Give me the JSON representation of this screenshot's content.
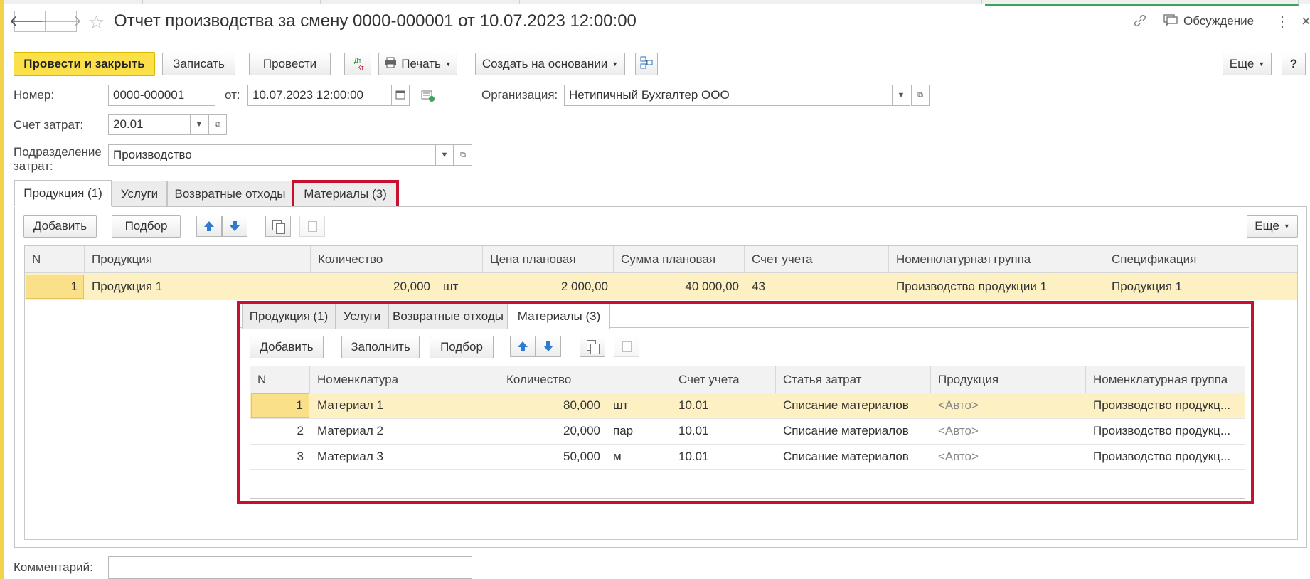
{
  "window": {
    "title": "Отчет производства за смену 0000-000001 от 10.07.2023 12:00:00",
    "discussion_label": "Обсуждение"
  },
  "toolbar": {
    "post_close": "Провести и закрыть",
    "save": "Записать",
    "post": "Провести",
    "dtkt_top": "Дт",
    "dtkt_bottom": "Кт",
    "print": "Печать",
    "create_based": "Создать на основании",
    "more": "Еще",
    "help": "?"
  },
  "form": {
    "number_label": "Номер:",
    "number_value": "0000-000001",
    "date_label": "от:",
    "date_value": "10.07.2023 12:00:00",
    "org_label": "Организация:",
    "org_value": "Нетипичный Бухгалтер ООО",
    "account_label": "Счет затрат:",
    "account_value": "20.01",
    "dept_label_1": "Подразделение",
    "dept_label_2": "затрат:",
    "dept_value": "Производство",
    "comment_label": "Комментарий:",
    "comment_value": ""
  },
  "tabs": [
    {
      "label": "Продукция (1)"
    },
    {
      "label": "Услуги"
    },
    {
      "label": "Возвратные отходы"
    },
    {
      "label": "Материалы (3)"
    }
  ],
  "outer_table": {
    "add": "Добавить",
    "pick": "Подбор",
    "more": "Еще",
    "headers": [
      "N",
      "Продукция",
      "Количество",
      "Цена плановая",
      "Сумма плановая",
      "Счет учета",
      "Номенклатурная группа",
      "Спецификация"
    ],
    "rows": [
      {
        "n": "1",
        "product": "Продукция 1",
        "qty": "20,000",
        "unit": "шт",
        "price": "2 000,00",
        "sum": "40 000,00",
        "account": "43",
        "group": "Производство продукции 1",
        "spec": "Продукция 1"
      }
    ]
  },
  "inner_tabs": [
    {
      "label": "Продукция (1)"
    },
    {
      "label": "Услуги"
    },
    {
      "label": "Возвратные отходы"
    },
    {
      "label": "Материалы (3)"
    }
  ],
  "inner_table": {
    "add": "Добавить",
    "fill": "Заполнить",
    "pick": "Подбор",
    "headers": [
      "N",
      "Номенклатура",
      "Количество",
      "Счет учета",
      "Статья затрат",
      "Продукция",
      "Номенклатурная группа"
    ],
    "rows": [
      {
        "n": "1",
        "item": "Материал 1",
        "qty": "80,000",
        "unit": "шт",
        "account": "10.01",
        "cost": "Списание материалов",
        "product": "<Авто>",
        "group": "Производство продукц..."
      },
      {
        "n": "2",
        "item": "Материал 2",
        "qty": "20,000",
        "unit": "пар",
        "account": "10.01",
        "cost": "Списание материалов",
        "product": "<Авто>",
        "group": "Производство продукц..."
      },
      {
        "n": "3",
        "item": "Материал 3",
        "qty": "50,000",
        "unit": "м",
        "account": "10.01",
        "cost": "Списание материалов",
        "product": "<Авто>",
        "group": "Производство продукц..."
      }
    ]
  },
  "colors": {
    "primary_button": "#fbe04a",
    "highlight_box": "#c8102e",
    "selected_row": "#fdf1c4",
    "selected_cell": "#fbe08a"
  }
}
